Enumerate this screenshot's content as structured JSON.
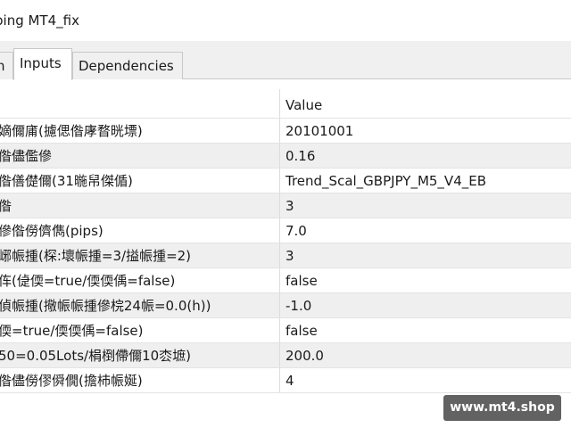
{
  "window": {
    "title": "ping MT4_fix"
  },
  "tabs": [
    {
      "label": "n"
    },
    {
      "label": "Inputs"
    },
    {
      "label": "Dependencies"
    }
  ],
  "grid": {
    "header": {
      "name": "",
      "value": "Value"
    },
    "rows": [
      {
        "name": "嫡儞庯(攄偲偺庨暓晄墂)",
        "value": "20101001"
      },
      {
        "name": "偺儘儖傪",
        "value": "0.16"
      },
      {
        "name": "偺僐儊儞(31暆帠傑偱)",
        "value": "Trend_Scal_GBPJPY_M5_V4_EB"
      },
      {
        "name": "偺",
        "value": "3"
      },
      {
        "name": "傪偺僗儕儁(pips)",
        "value": "7.0"
      },
      {
        "name": "峫帪揰(棎:壞帪揰=3/搤帪揰=2)",
        "value": "3"
      },
      {
        "name": "伡(偼偄=true/偄偄偊=false)",
        "value": "false"
      },
      {
        "name": "偵帪揰(擏帪帪揰傪梡24帪=0.0(h))",
        "value": "-1.0"
      },
      {
        "name": "偄=true/偄偄偊=false)",
        "value": "false"
      },
      {
        "name": "50=0.05Lots/梋椡僀儞10枩墌)",
        "value": "200.0"
      },
      {
        "name": "偺儘僗僇僢僩(擔杮帪娫)",
        "value": "4"
      }
    ]
  },
  "watermark": {
    "text": "www.mt4.shop"
  }
}
